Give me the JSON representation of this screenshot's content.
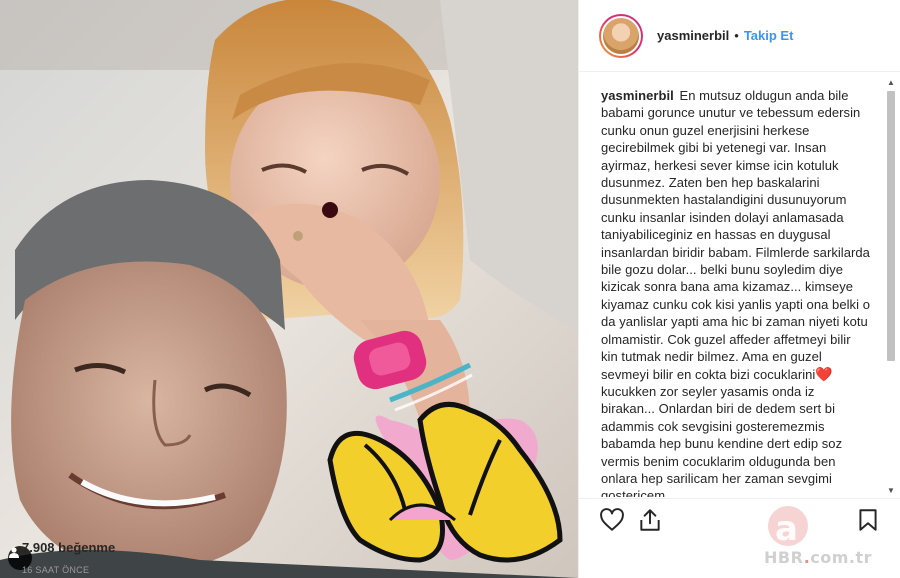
{
  "post": {
    "username": "yasminerbil",
    "separator": "•",
    "follow_label": "Takip Et",
    "caption_user": "yasminerbil",
    "caption_text_1": "En mutsuz oldugun anda bile babami gorunce unutur ve tebessum edersin cunku onun guzel enerjisini herkese gecirebilmek gibi bi yetenegi var. Insan ayirmaz, herkesi sever kimse icin kotuluk dusunmez. Zaten ben hep baskalarini dusunmekten hastalandigini dusunuyorum cunku insanlar isinden dolayi anlamasada taniyabiliceginiz en hassas en duygusal insanlardan biridir babam. Filmlerde sarkilarda bile gozu dolar... belki bunu soyledim diye kizicak sonra bana ama kizamaz... kimseye kiyamaz cunku cok kisi yanlis yapti ona belki o da yanlislar yapti ama hic bi zaman niyeti kotu olmamistir. Cok guzel affeder affetmeyi bilir kin tutmak nedir bilmez. Ama en guzel sevmeyi bilir en cokta bizi cocuklarini",
    "caption_emoji": "❤️",
    "caption_text_2": " kucukken zor seyler yasamis onda iz birakan... Onlardan biri de dedem sert bi adammis cok sevgisini gosteremezmis babamda hep bunu kendine dert edip soz vermis benim cocuklarim oldugunda ben onlara hep sarilicam her zaman sevgimi gostericem",
    "likes": "7.908 beğenme",
    "time_ago": "16 SAAT ÖNCE"
  },
  "icons": {
    "like": "heart-outline-icon",
    "share": "share-upload-icon",
    "save": "bookmark-icon",
    "tag": "person-tag-icon",
    "scroll_up": "scroll-up-arrow-icon",
    "scroll_down": "scroll-down-arrow-icon"
  },
  "watermark": {
    "logo_letter": "a",
    "text_hbr": "HBR",
    "text_dot": ".",
    "text_tld": "com.tr"
  },
  "colors": {
    "link_blue": "#3897f0",
    "border": "#efefef",
    "text": "#262626",
    "muted": "#999999"
  }
}
